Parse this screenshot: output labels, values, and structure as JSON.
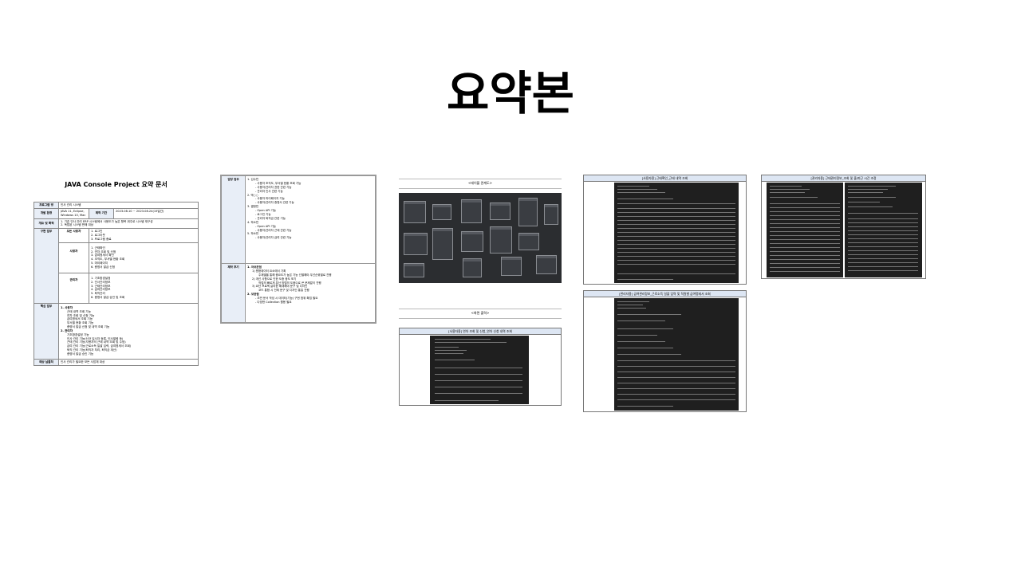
{
  "slide": {
    "title": "요약본"
  },
  "doc1": {
    "title": "JAVA Console Project 요약 문서",
    "rows": [
      {
        "label": "프로그램 명",
        "value": "인사 관리 시스템"
      },
      {
        "label": "개발 환경",
        "value": "JAVA 11, Eclipse, Windows 10, Mac",
        "extra_label": "제작 기간",
        "extra_value": "2023.08.10 ~ 2023.08.24(15일간)"
      },
      {
        "label": "개요 및 목적",
        "lines": [
          "1. 기존 인사 관리 ERP 시스템에서 사용도가 높은 항목 위주로 시스템 재구성",
          "2. 독립된 시스템 판매 대상"
        ]
      }
    ],
    "impl": {
      "label": "구현 업무",
      "groups": [
        {
          "name": "모든 사용자",
          "items": [
            "1. 로그인",
            "2. 로그아웃",
            "3. 프로그램 종료"
          ]
        },
        {
          "name": "사용자",
          "items": [
            "1. 근태확인",
            "2. 연차 조회 및 신청",
            "3. 급여명세서 확인",
            "4. 조직도, 부서별 현황 조회",
            "5. 마이페이지",
            "6. 증명서 발급 신청"
          ]
        },
        {
          "name": "관리자",
          "items": [
            "1. 기초환경설정",
            "2. 인사관리정보",
            "3. 근태관리정보",
            "4. 급여관리정보",
            "5. 퇴직관리",
            "6. 증명서 발급 승인 및 조회"
          ]
        }
      ]
    },
    "core": {
      "label": "핵심 업무",
      "sections": [
        {
          "heading": "1. 사용자",
          "items": [
            "근태 내역 조회 기능",
            "연차 조회 및 신청 기능",
            "급여명세서 조회 기능",
            "부서별 현황 조회 기능",
            "증명서 발급 신청 및 내역 조회 기능"
          ]
        },
        {
          "heading": "2. 관리자",
          "items": [
            "기초환경설정 기능",
            "인사 관리 기능(신규 입사자 등록, 인사발령 등)",
            "근태 관리 기능(사용자의 근태 내역 조회 및 수정)",
            "급여 관리 기능(근로소득 일괄 입력, 급여명세서 조회)",
            "퇴직 관리 기능(퇴직자 처리, 퇴직금 계산)",
            "증명서 발급 승인 기능"
          ]
        }
      ]
    },
    "target": {
      "label": "예상 납품처",
      "value": "인사 관리가 필요한 모든 사업체 대상"
    }
  },
  "doc2": {
    "role_label": "담당 업무",
    "role_lines": [
      "1. 김수민",
      "- 사용자 조직도, 부서별 현황 조회 기능",
      "- 사용자/관리자 권한 관련 기능",
      "- 관리자 인사 관련 기능",
      "2. 박○○",
      "- 사용자 마이페이지 기능",
      "- 사용자/관리자 증명서 관련 기능",
      "3. 결현빈",
      "- Open API 기능",
      "- 로그인 기능",
      "- 관리자 퇴직금 관련 기능",
      "4. 하소빈",
      "- Open API 기능",
      "- 사용자/관리자 근태 관련 기능",
      "5. 하소빈",
      "- 사용자/관리자 급여 관련 기능"
    ],
    "review_label": "제작 후기",
    "review_lines": [
      "1. 아쉬운점",
      "1) 원형데이터 요소에서 기획",
      "주제별을 통해 중요도가 높은 기능 선별해야 우선순위별로 진행",
      "2) 개선 사항으로 인한 도중 중도 포기",
      "작업의 빠르게 분산 방법의 도움으로 큰 문제없이 진행",
      "3) 요단 프로젝 갈리한 해새해야 문구 및 디자인",
      "코드 통합 시 전체 문구 및 디자인 통일 진행",
      "2. 보완점",
      "- 초반 문서 작성 시 데이터(기능) 구현 범위 확립 필요",
      "- 다양한 Collection 활용 필요"
    ]
  },
  "erd": {
    "caption": "<테이블 관계도>"
  },
  "screens": {
    "section_caption": "<화면 출력>",
    "screen1": "[사용자용] 연차 조회 및 신청_연차 신청 내역 조회",
    "screen2": "[사용자용] 근태확인_근태 내역 조회",
    "screen3": "[관리자용] 급여관리정보_근로소득 일괄 입력 및 직원별 급여명세서 조회",
    "screen4": "[관리자용] 근태관리정보_조회 및 출/퇴근 시간 조정"
  }
}
